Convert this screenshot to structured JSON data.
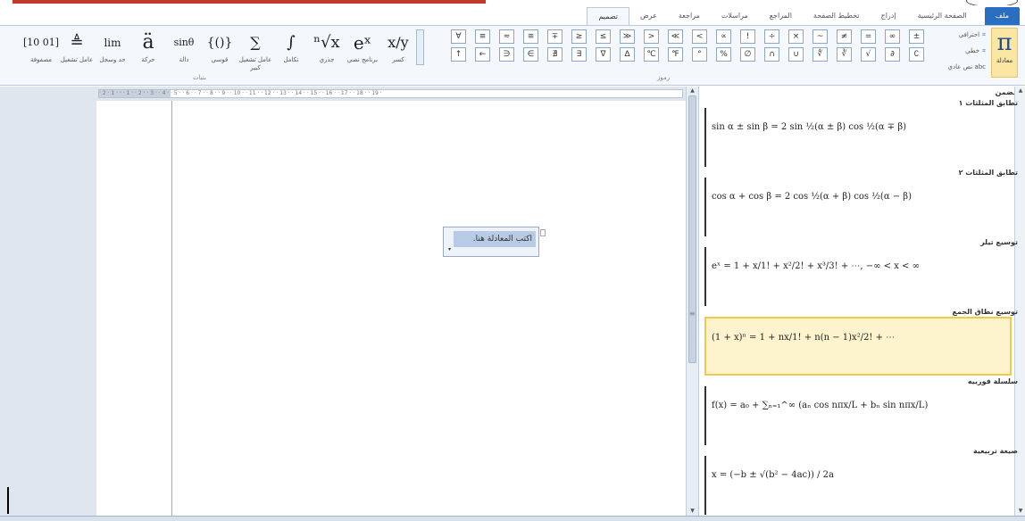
{
  "tabs": [
    {
      "label": "ملف",
      "kind": "file"
    },
    {
      "label": "الصفحة الرئيسية"
    },
    {
      "label": "إدراج"
    },
    {
      "label": "تخطيط الصفحة"
    },
    {
      "label": "المراجع"
    },
    {
      "label": "مراسلات"
    },
    {
      "label": "مراجعة"
    },
    {
      "label": "عرض"
    },
    {
      "label": "تصميم",
      "kind": "active"
    }
  ],
  "ribbon": {
    "equation_button": {
      "glyph": "π",
      "label": "معادلة"
    },
    "options": [
      "احترافي",
      "خطي",
      "abc نص عادي"
    ],
    "symbols_top": [
      "±",
      "∞",
      "=",
      "≠",
      "~",
      "×",
      "÷",
      "!",
      "∝",
      "<",
      "≪",
      ">",
      "≫",
      "≤",
      "≥",
      "∓",
      "≅",
      "≈",
      "≡",
      "∀"
    ],
    "symbols_bottom": [
      "∁",
      "∂",
      "√",
      "∛",
      "∜",
      "∪",
      "∩",
      "∅",
      "%",
      "°",
      "℉",
      "℃",
      "∆",
      "∇",
      "∃",
      "∄",
      "∈",
      "∋",
      "←",
      "↑"
    ],
    "symbols_group_label": "رموز",
    "structures": [
      {
        "glyph": "x/y",
        "label": "كسر"
      },
      {
        "glyph": "eˣ",
        "label": "برنامج نصي"
      },
      {
        "glyph": "ⁿ√x",
        "label": "جذري"
      },
      {
        "glyph": "∫",
        "label": "تكامل"
      },
      {
        "glyph": "∑",
        "label": "عامل تشغيل كبير"
      },
      {
        "glyph": "{()}",
        "label": "قوسي"
      },
      {
        "glyph": "sinθ",
        "label": "دالة"
      },
      {
        "glyph": "ä",
        "label": "حركة"
      },
      {
        "glyph": "lim",
        "label": "حد وسجل"
      },
      {
        "glyph": "≜",
        "label": "عامل تشغيل"
      },
      {
        "glyph": "[10 01]",
        "label": "مصفوفة"
      }
    ],
    "structures_group_label": "بنيات"
  },
  "ruler": {
    "ticks": "· 2 · 1 · · · 1 · · 2 · · 3 · · 4 · · 5 · · 6 · · 7 · · 8 · · 9 · · 10 · · 11 · · 12 · · 13 · · 14 · · 15 · · 16 · · 17 · · 18 · · 19 ·"
  },
  "document": {
    "placeholder_text": "اكتب المعادلة هنا."
  },
  "gallery": {
    "header": "مضمن",
    "items": [
      {
        "title": "تطابق المثلثات ١",
        "formula": "sin α ± sin β = 2 sin ½(α ± β) cos ½(α ∓ β)"
      },
      {
        "title": "تطابق المثلثات ٢",
        "formula": "cos α + cos β = 2 cos ½(α + β) cos ½(α − β)"
      },
      {
        "title": "توسيع تيلر",
        "formula": "eˣ = 1 + x/1! + x²/2! + x³/3! + ⋯,      −∞ < x < ∞"
      },
      {
        "title": "توسيع نطاق الجمع",
        "formula": "(1 + x)ⁿ = 1 + nx/1! + n(n − 1)x²/2! + ⋯",
        "selected": true
      },
      {
        "title": "سلسلة فورييه",
        "formula": "f(x) = a₀ + ∑ₙ₌₁^∞ (aₙ cos nπx/L + bₙ sin nπx/L)"
      },
      {
        "title": "صيغة تربيعية",
        "formula": "x = (−b ± √(b² − 4ac)) / 2a"
      }
    ]
  }
}
